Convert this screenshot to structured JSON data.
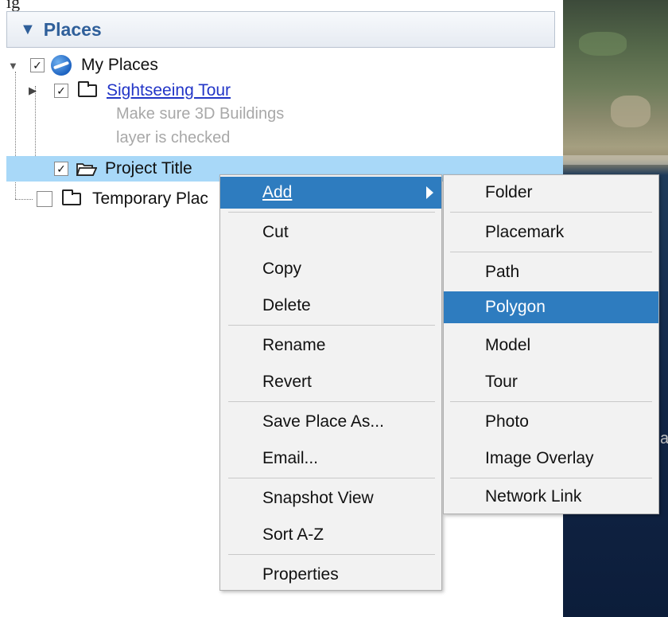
{
  "top_clip_text": "ig",
  "panel": {
    "title": "Places",
    "collapse_glyph": "▼"
  },
  "tree": {
    "my_places": {
      "label": "My Places",
      "checked": true,
      "icon": "globe-icon"
    },
    "sightseeing": {
      "label": "Sightseeing Tour",
      "checked": true,
      "icon": "folder-icon"
    },
    "sightseeing_desc_line1": "Make sure 3D Buildings",
    "sightseeing_desc_line2": "layer is checked",
    "project_title": {
      "label": "Project Title",
      "checked": true,
      "icon": "open-folder-icon"
    },
    "temporary": {
      "label": "Temporary Plac",
      "checked": false,
      "icon": "folder-icon"
    }
  },
  "context_menu": {
    "items": [
      {
        "label": "Add",
        "has_submenu": true,
        "active": true
      },
      {
        "label": "Cut"
      },
      {
        "label": "Copy"
      },
      {
        "label": "Delete"
      },
      {
        "label": "Rename"
      },
      {
        "label": "Revert"
      },
      {
        "label": "Save Place As..."
      },
      {
        "label": "Email..."
      },
      {
        "label": "Snapshot View"
      },
      {
        "label": "Sort A-Z"
      },
      {
        "label": "Properties"
      }
    ]
  },
  "add_submenu": {
    "items": [
      {
        "label": "Folder"
      },
      {
        "label": "Placemark"
      },
      {
        "label": "Path"
      },
      {
        "label": "Polygon",
        "active": true
      },
      {
        "label": "Model"
      },
      {
        "label": "Tour"
      },
      {
        "label": "Photo"
      },
      {
        "label": "Image Overlay"
      },
      {
        "label": "Network Link"
      }
    ]
  },
  "map_edge_char": "a",
  "colors": {
    "header_text": "#2f5f9a",
    "selection_bg": "#a8d8f8",
    "menu_highlight": "#2e7cbf",
    "link": "#2235c7"
  }
}
